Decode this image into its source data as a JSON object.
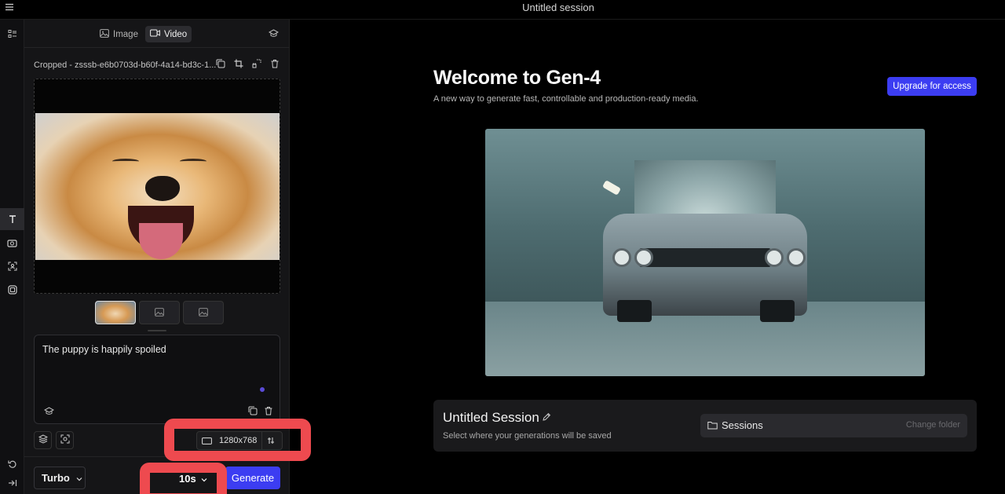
{
  "window": {
    "title": "Untitled session"
  },
  "panel": {
    "tabs": [
      {
        "label": "Image"
      },
      {
        "label": "Video"
      }
    ],
    "filename": "Cropped - zsssb-e6b0703d-b60f-4a14-bd3c-1...",
    "prompt_text": "The puppy is happily spoiled",
    "resolution": "1280x768",
    "model": "Turbo",
    "duration": "10s",
    "generate_label": "Generate"
  },
  "main": {
    "welcome_title": "Welcome to Gen-4",
    "welcome_subtitle": "A new way to generate fast, controllable and production-ready media.",
    "upgrade_label": "Upgrade for access",
    "session_title": "Untitled Session",
    "session_hint": "Select where your generations will be saved",
    "folder_label": "Sessions",
    "change_folder_label": "Change folder"
  },
  "colors": {
    "accent": "#3c3df2",
    "highlight": "#ee4a4f"
  }
}
